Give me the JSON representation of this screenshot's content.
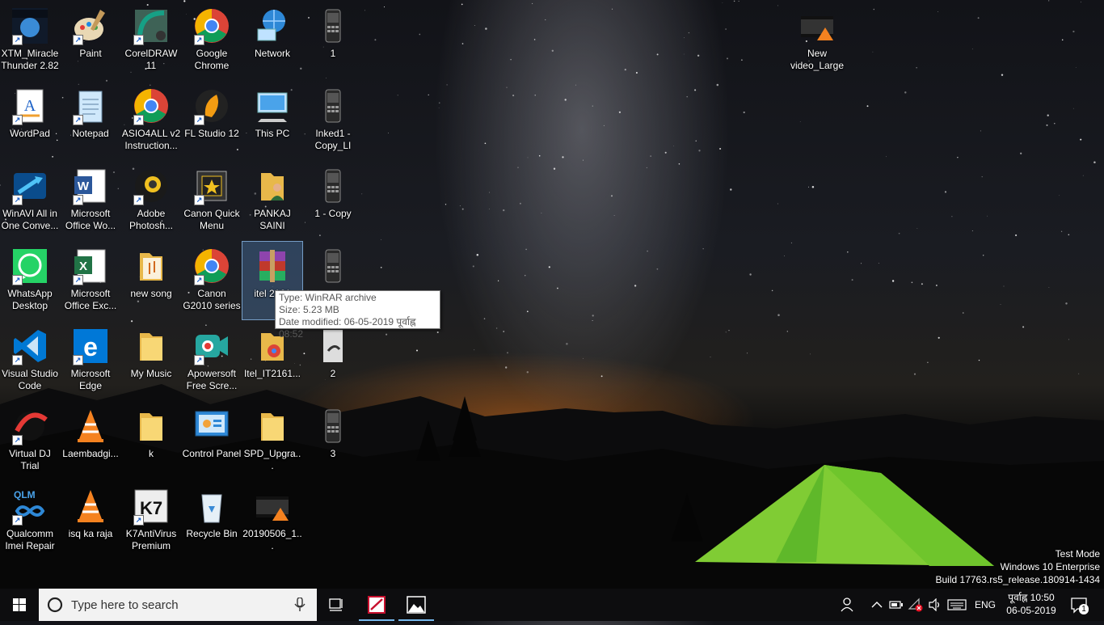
{
  "desktop": {
    "icons": [
      {
        "label": "XTM_Miracle Thunder 2.82",
        "kind": "xtm-icon",
        "shortcut": true
      },
      {
        "label": "Paint",
        "kind": "paint-icon",
        "shortcut": true
      },
      {
        "label": "CorelDRAW 11",
        "kind": "coreldraw-icon",
        "shortcut": true
      },
      {
        "label": "Google Chrome",
        "kind": "chrome-icon",
        "shortcut": true
      },
      {
        "label": "Network",
        "kind": "network-icon",
        "shortcut": false
      },
      {
        "label": "1",
        "kind": "phone-image-icon",
        "shortcut": false
      },
      {
        "label": "WordPad",
        "kind": "wordpad-icon",
        "shortcut": true
      },
      {
        "label": "Notepad",
        "kind": "notepad-icon",
        "shortcut": true
      },
      {
        "label": "ASIO4ALL v2 Instruction...",
        "kind": "chrome-icon",
        "shortcut": true
      },
      {
        "label": "FL Studio 12",
        "kind": "flstudio-icon",
        "shortcut": true
      },
      {
        "label": "This PC",
        "kind": "this-pc-icon",
        "shortcut": false
      },
      {
        "label": "Inked1 - Copy_LI",
        "kind": "phone-image-icon",
        "shortcut": false
      },
      {
        "label": "WinAVI All in One Conve...",
        "kind": "winavi-icon",
        "shortcut": true
      },
      {
        "label": "Microsoft Office Wo...",
        "kind": "word-icon",
        "shortcut": true
      },
      {
        "label": "Adobe Photosh...",
        "kind": "photoshop-icon",
        "shortcut": true
      },
      {
        "label": "Canon Quick Menu",
        "kind": "canon-menu-icon",
        "shortcut": true
      },
      {
        "label": "PANKAJ SAINI",
        "kind": "user-folder-icon",
        "shortcut": false
      },
      {
        "label": "1 - Copy",
        "kind": "phone-image-icon",
        "shortcut": false
      },
      {
        "label": "WhatsApp Desktop",
        "kind": "whatsapp-icon",
        "shortcut": true
      },
      {
        "label": "Microsoft Office Exc...",
        "kind": "excel-icon",
        "shortcut": true
      },
      {
        "label": "new song",
        "kind": "music-folder-icon",
        "shortcut": false
      },
      {
        "label": "Canon G2010 series Onlin...",
        "kind": "chrome-icon",
        "shortcut": true
      },
      {
        "label": "itel 2161",
        "kind": "winrar-icon",
        "shortcut": false
      },
      {
        "label": "",
        "kind": "phone-image-icon",
        "shortcut": false
      },
      {
        "label": "Visual Studio Code",
        "kind": "vscode-icon",
        "shortcut": true
      },
      {
        "label": "Microsoft Edge",
        "kind": "edge-icon",
        "shortcut": true
      },
      {
        "label": "My Music",
        "kind": "folder-icon",
        "shortcut": false
      },
      {
        "label": "Apowersoft Free Scre...",
        "kind": "apowersoft-icon",
        "shortcut": true
      },
      {
        "label": "Itel_IT2161...",
        "kind": "chrome-folder-icon",
        "shortcut": false
      },
      {
        "label": "2",
        "kind": "photo-icon",
        "shortcut": false
      },
      {
        "label": "Virtual DJ Trial",
        "kind": "virtualdj-icon",
        "shortcut": true
      },
      {
        "label": "Laembadgi...",
        "kind": "vlc-icon",
        "shortcut": false
      },
      {
        "label": "k",
        "kind": "folder-icon",
        "shortcut": false
      },
      {
        "label": "Control Panel",
        "kind": "control-panel-icon",
        "shortcut": false
      },
      {
        "label": "SPD_Upgra...",
        "kind": "folder-icon",
        "shortcut": false
      },
      {
        "label": "3",
        "kind": "phone-image-icon",
        "shortcut": false
      },
      {
        "label": "Qualcomm Imei Repair ...",
        "kind": "qualcomm-icon",
        "shortcut": true
      },
      {
        "label": "isq ka raja",
        "kind": "vlc-icon",
        "shortcut": false
      },
      {
        "label": "K7AntiVirus Premium",
        "kind": "k7-icon",
        "shortcut": true
      },
      {
        "label": "Recycle Bin",
        "kind": "recycle-bin-icon",
        "shortcut": false
      },
      {
        "label": "20190506_1...",
        "kind": "video-file-icon",
        "shortcut": false
      },
      {
        "label": "New video_Large",
        "kind": "video-file-icon",
        "shortcut": false
      }
    ]
  },
  "tooltip": {
    "type": "Type: WinRAR archive",
    "size": "Size: 5.23 MB",
    "date": "Date modified: 06-05-2019 पूर्वाह्न 08:52"
  },
  "watermark": {
    "line1": "Test Mode",
    "line2": "Windows 10 Enterprise",
    "line3": "Build 17763.rs5_release.180914-1434"
  },
  "taskbar": {
    "search_placeholder": "Type here to search",
    "language": "ENG",
    "time": "पूर्वाह्न 10:50",
    "date": "06-05-2019",
    "notification_count": "1",
    "pinned": [
      "coreldraw-icon",
      "photos-icon"
    ]
  },
  "colors": {
    "taskbar": "#0d0d0f",
    "search_bg": "#f2f2f2",
    "accent": "#76b9ed",
    "tent_green": "#8ee23a"
  }
}
